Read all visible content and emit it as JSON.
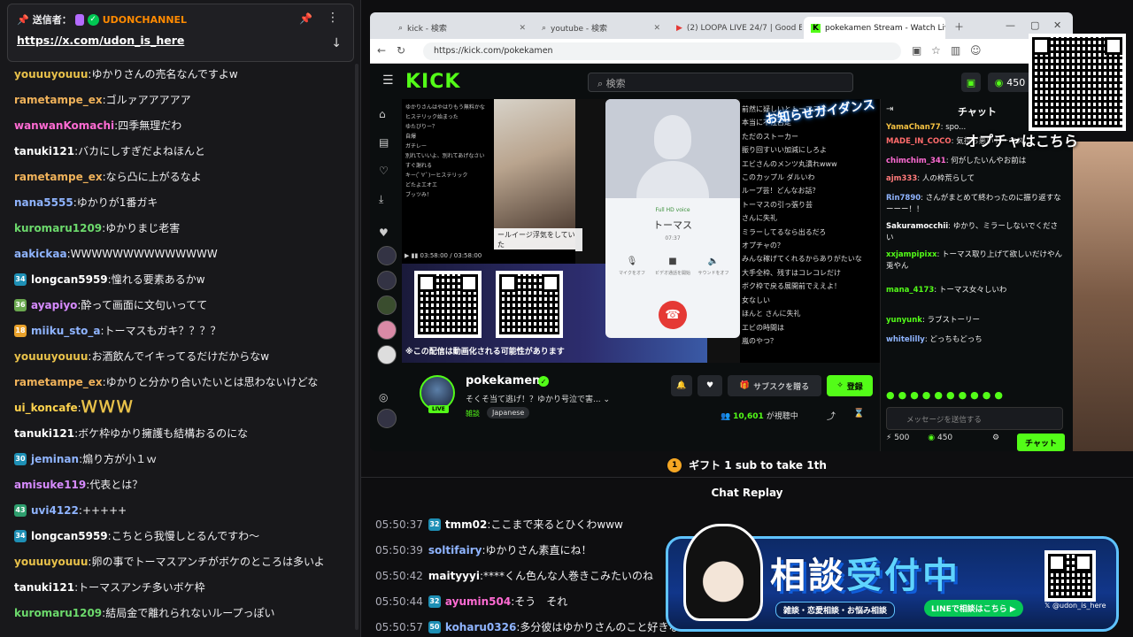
{
  "left_chat": {
    "pinned": {
      "sender_label": "送信者：",
      "sender_name": "UDONCHANNEL",
      "link": "https://x.com/udon_is_here"
    },
    "messages": [
      {
        "user": "youuuyouuu",
        "color": "#e8c14a",
        "text": "ゆかりさんの売名なんですよw"
      },
      {
        "user": "rametampe_ex",
        "color": "#f0b25a",
        "text": "ゴルァアアアアア"
      },
      {
        "user": "wanwanKomachi",
        "color": "#ff6bd3",
        "text": "四季無理だわ"
      },
      {
        "user": "tanuki121",
        "color": "#ffffff",
        "text": "バカにしすぎだよねほんと"
      },
      {
        "user": "rametampe_ex",
        "color": "#f0b25a",
        "text": "なら凸に上がるなよ"
      },
      {
        "user": "nana5555",
        "color": "#8fb4ff",
        "text": "ゆかりが1番ガキ"
      },
      {
        "user": "kuromaru1209",
        "color": "#6cd96c",
        "text": "ゆかりまじ老害"
      },
      {
        "user": "aakickaa",
        "color": "#8fb4ff",
        "text": "WWWWWWWWWWWWWW"
      },
      {
        "badge": "34",
        "badge_color": "#1e8fb5",
        "user": "longcan5959",
        "color": "#ffffff",
        "text": "憧れる要素あるかw"
      },
      {
        "badge": "36",
        "badge_color": "#6aa84f",
        "user": "ayapiyo",
        "color": "#d78bff",
        "text": "酔って画面に文句いってて"
      },
      {
        "badge": "18",
        "badge_color": "#e8a12b",
        "user": "miiku_sto_a",
        "color": "#8fb4ff",
        "text": "トーマスもガキ？？？？"
      },
      {
        "user": "youuuyouuu",
        "color": "#e8c14a",
        "text": "お酒飲んでイキってるだけだからなw"
      },
      {
        "user": "rametampe_ex",
        "color": "#f0b25a",
        "text": "ゆかりと分かり合いたいとは思わないけどな"
      },
      {
        "user": "ui_koncafe",
        "color": "#ffd34d",
        "text": "",
        "www": "ＷＷＷ"
      },
      {
        "user": "tanuki121",
        "color": "#ffffff",
        "text": "ボケ枠ゆかり擁護も結構おるのにな"
      },
      {
        "badge": "30",
        "badge_color": "#1e8fb5",
        "user": "jeminan",
        "color": "#8fb4ff",
        "text": "煽り方が小１ｗ"
      },
      {
        "user": "amisuke119",
        "color": "#d78bff",
        "text": "代表とは？"
      },
      {
        "badge": "43",
        "badge_color": "#2e9e6e",
        "user": "uvi4122",
        "color": "#8fb4ff",
        "text": "+++++"
      },
      {
        "badge": "34",
        "badge_color": "#1e8fb5",
        "user": "longcan5959",
        "color": "#ffffff",
        "text": "こちとら我慢しとるんですわ〜"
      },
      {
        "user": "youuuyouuu",
        "color": "#e8c14a",
        "text": "卵の事でトーマスアンチがボケのところは多いよ"
      },
      {
        "user": "tanuki121",
        "color": "#ffffff",
        "text": "トーマスアンチ多いボケ枠"
      },
      {
        "user": "kuromaru1209",
        "color": "#6cd96c",
        "text": "結局金で離れられないループっぽい"
      }
    ]
  },
  "browser": {
    "tabs": [
      {
        "label": "kick - 検索"
      },
      {
        "label": "youtube - 検索"
      },
      {
        "label": "(2) LOOPA LIVE 24/7 | Good Ener..."
      },
      {
        "label": "pokekamen Stream - Watch Live"
      }
    ],
    "url": "https://kick.com/pokekamen"
  },
  "kick": {
    "search_placeholder": "検索",
    "points": "450",
    "video": {
      "chat_lines": [
        "ゆかりさんはやはりもう無料かな",
        "ヒステリック始まった",
        "ゆたびりー？",
        "自爆",
        "ガチレー",
        "別れていいよ、別れてあげなさい",
        "すぐ謝れる",
        "キー(ﾟ∀ﾟ)ーヒステリック",
        "どたよエオエ",
        "ブッツみ！"
      ],
      "caption": "ールイージ浮気をしていた\nー！の時トーマスくんとは別",
      "progress_time": "03:58:00 / 03:58:00",
      "notice": "※この配信は動画化される可能性があります",
      "title_art": "お知らせガイダンス",
      "phone": {
        "hd_label": "Full HD voice",
        "name": "トーマス",
        "time": "07:37",
        "btn_mute": "マイクをオフ",
        "btn_video": "ビデオ通話を開始",
        "btn_speaker": "サウンドをオフ"
      },
      "right_text": [
        "前然に疑しいとトーマスは",
        "本当に不社否定",
        "ただのストーカー",
        "振り回すいい加減にしろよ",
        "エビさんのメンツ丸潰れwww",
        "このカップル ダルいわ",
        "ループ芸！どんなお話？",
        "トーマスの引っ張り芸",
        "さんに失礼",
        "ミラーしてるなら出るだろ",
        "オプチャの？",
        "みんな稼げてくれるからありがたいな",
        "大手全枠、残すはコレコレだけ",
        "ボク枠で戻る展開前でええよ！",
        "女なしい",
        "ほんと さんに失礼",
        "エビの時間は",
        "嵐のやつ？"
      ]
    },
    "streamer": {
      "name": "pokekamen",
      "live": "LIVE",
      "title": "そくそ当て逃げ！？ゆかり号泣で害...",
      "category": "雑談",
      "language": "Japanese",
      "viewers": "10,601",
      "viewers_label": "が視聴中",
      "gift_label": "サブスクを贈る",
      "follow_label": "登録"
    },
    "chat": {
      "title": "チャット",
      "messages": [
        {
          "user": "YamaChan77",
          "color": "#f5c242",
          "text": "spo..."
        },
        {
          "user": "MADE_IN_COCO",
          "color": "#ff6b6b",
          "text": "気持ち悪いトーマス"
        },
        {
          "user": "chimchim_341",
          "color": "#ff6bd3",
          "text": "何がしたいんやお前は"
        },
        {
          "user": "ajm333",
          "color": "#ff7a7a",
          "text": "人の枠荒らして"
        },
        {
          "user": "Rin7890",
          "color": "#8fb4ff",
          "text": "さんがまとめて終わったのに振り返すなーーー！！"
        },
        {
          "user": "Sakuramocchii",
          "color": "#ffffff",
          "text": "ゆかり、ミラーしないでください"
        },
        {
          "user": "xxjampipixx",
          "color": "#53fc18",
          "text": "トーマス取り上げて欲しいだけやん兎やん"
        },
        {
          "user": "mana_4173",
          "color": "#53fc18",
          "text": "トーマス女々しいわ"
        },
        {
          "user": "yunyunk",
          "color": "#53fc18",
          "text": "ラブストーリー"
        },
        {
          "user": "whitelilly",
          "color": "#8fb4ff",
          "text": "どっちもどっち"
        }
      ],
      "input_placeholder": "メッセージを送信する",
      "stat_a": "500",
      "stat_b": "450",
      "send_label": "チャット"
    }
  },
  "overlay": {
    "oshirase": "オプチャはこちら"
  },
  "gift_bar": {
    "coin": "1",
    "text": "ギフト 1 sub to take 1th"
  },
  "replay": {
    "title": "Chat Replay",
    "messages": [
      {
        "time": "05:50:37",
        "badge": "32",
        "user": "tmm02",
        "color": "#ffffff",
        "text": "ここまで来るとひくわwww"
      },
      {
        "time": "05:50:39",
        "user": "soltifairy",
        "color": "#8fb4ff",
        "text": "ゆかりさん素直にね！"
      },
      {
        "time": "05:50:42",
        "user": "maityyyi",
        "color": "#ffffff",
        "text": "****くん色んな人巻きこみたいのね"
      },
      {
        "time": "05:50:44",
        "badge": "32",
        "user": "ayumin504",
        "color": "#ff6bd3",
        "text": "そう　それ"
      },
      {
        "time": "05:50:57",
        "badge": "50",
        "user": "koharu0326",
        "color": "#8fb4ff",
        "text": "多分彼はゆかりさんのこと好きな..."
      }
    ]
  },
  "banner": {
    "main_a": "相談",
    "main_b": "受付中",
    "sub": "雑談・恋愛相談・お悩み相談",
    "line": "LINEで相談はこちら",
    "x_handle": "@udon_is_here"
  }
}
